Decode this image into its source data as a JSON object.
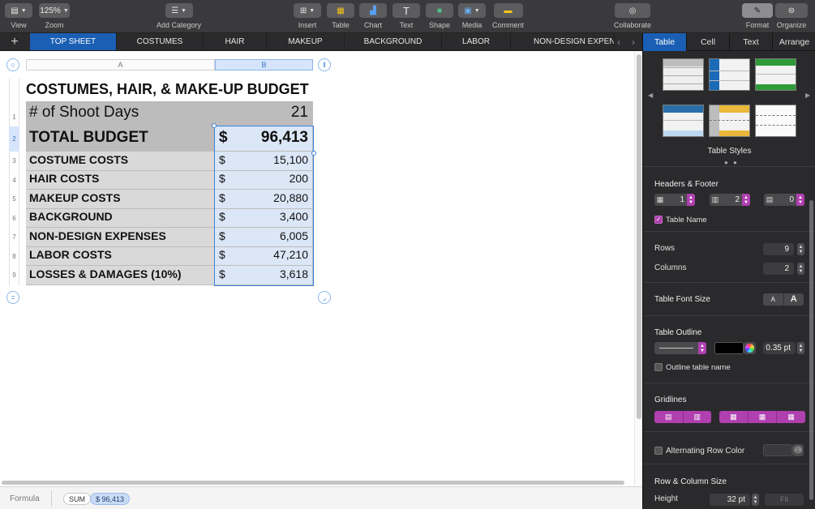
{
  "toolbar": {
    "view_label": "View",
    "zoom_value": "125%",
    "zoom_label": "Zoom",
    "add_category_label": "Add Category",
    "insert_label": "Insert",
    "table_label": "Table",
    "chart_label": "Chart",
    "text_label": "Text",
    "shape_label": "Shape",
    "media_label": "Media",
    "comment_label": "Comment",
    "collaborate_label": "Collaborate",
    "format_label": "Format",
    "organize_label": "Organize"
  },
  "sheet_tabs": [
    "TOP SHEET",
    "COSTUMES",
    "HAIR",
    "MAKEUP",
    "BACKGROUND",
    "LABOR",
    "NON-DESIGN EXPENSES"
  ],
  "active_sheet": "TOP SHEET",
  "canvas": {
    "col_a": "A",
    "col_b": "B",
    "table_title": "COSTUMES, HAIR, & MAKE-UP BUDGET",
    "rows": [
      {
        "num": "1",
        "label": "# of Shoot Days",
        "currency": "",
        "value": "21"
      },
      {
        "num": "2",
        "label": "TOTAL BUDGET",
        "currency": "$",
        "value": "96,413"
      },
      {
        "num": "3",
        "label": "COSTUME COSTS",
        "currency": "$",
        "value": "15,100"
      },
      {
        "num": "4",
        "label": "HAIR COSTS",
        "currency": "$",
        "value": "200"
      },
      {
        "num": "5",
        "label": "MAKEUP COSTS",
        "currency": "$",
        "value": "20,880"
      },
      {
        "num": "6",
        "label": "BACKGROUND",
        "currency": "$",
        "value": "3,400"
      },
      {
        "num": "7",
        "label": "NON-DESIGN EXPENSES",
        "currency": "$",
        "value": "6,005"
      },
      {
        "num": "8",
        "label": "LABOR COSTS",
        "currency": "$",
        "value": "47,210"
      },
      {
        "num": "9",
        "label": "LOSSES & DAMAGES (10%)",
        "currency": "$",
        "value": "3,618"
      }
    ]
  },
  "formula_bar": {
    "label": "Formula",
    "function": "SUM",
    "reference": "$ 96,413"
  },
  "inspector": {
    "tabs": [
      "Table",
      "Cell",
      "Text",
      "Arrange"
    ],
    "active_tab": "Table",
    "styles_label": "Table Styles",
    "headers_footer": {
      "title": "Headers & Footer",
      "header_rows": "1",
      "header_cols": "2",
      "footer_rows": "0"
    },
    "table_name_label": "Table Name",
    "rows_label": "Rows",
    "rows_value": "9",
    "columns_label": "Columns",
    "columns_value": "2",
    "font_size_title": "Table Font Size",
    "font_small": "A",
    "font_large": "A",
    "outline_title": "Table Outline",
    "outline_width": "0.35 pt",
    "outline_name_label": "Outline table name",
    "gridlines_title": "Gridlines",
    "alt_row_label": "Alternating Row Color",
    "row_col_size_title": "Row & Column Size",
    "height_label": "Height",
    "height_value": "32 pt",
    "fit_label": "Fit"
  },
  "colors": {
    "accent": "#1a5fb4",
    "stepper_accent": "#b03fb0",
    "selection": "#3b82d8"
  }
}
